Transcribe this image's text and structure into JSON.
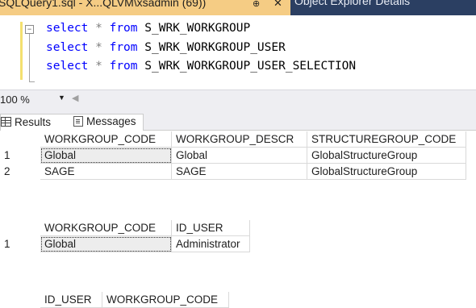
{
  "tabs": {
    "active_title": "SQLQuery1.sql - X...QLVM\\xsadmin (69))",
    "pin": "⊕",
    "close": "✕",
    "other": "Object Explorer Details"
  },
  "editor": {
    "lines": [
      {
        "kw": "select",
        "star": "*",
        "from": "from",
        "table": "S_WRK_WORKGROUP"
      },
      {
        "kw": "select",
        "star": "*",
        "from": "from",
        "table": "S_WRK_WORKGROUP_USER"
      },
      {
        "kw": "select",
        "star": "*",
        "from": "from",
        "table": "S_WRK_WORKGROUP_USER_SELECTION"
      }
    ]
  },
  "zoom": {
    "value": "100 %"
  },
  "results_tabs": {
    "results": "Results",
    "messages": "Messages"
  },
  "grid1": {
    "headers": [
      "WORKGROUP_CODE",
      "WORKGROUP_DESCR",
      "STRUCTUREGROUP_CODE"
    ],
    "rows": [
      {
        "n": "1",
        "cells": [
          "Global",
          "Global",
          "GlobalStructureGroup"
        ]
      },
      {
        "n": "2",
        "cells": [
          "SAGE",
          "SAGE",
          "GlobalStructureGroup"
        ]
      }
    ]
  },
  "grid2": {
    "headers": [
      "WORKGROUP_CODE",
      "ID_USER"
    ],
    "rows": [
      {
        "n": "1",
        "cells": [
          "Global",
          "Administrator"
        ]
      }
    ]
  },
  "grid3": {
    "headers": [
      "ID_USER",
      "WORKGROUP_CODE"
    ]
  }
}
